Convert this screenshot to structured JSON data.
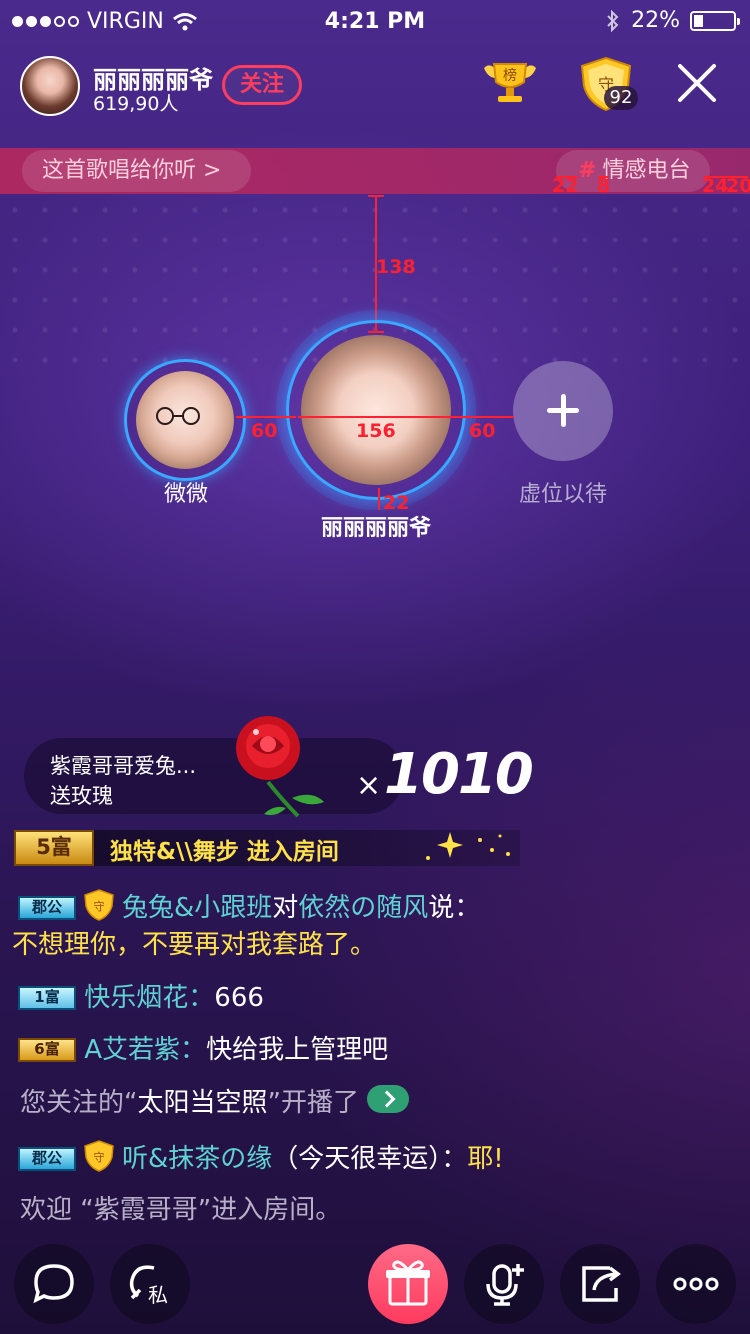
{
  "status_bar": {
    "carrier": "VIRGIN",
    "time": "4:21 PM",
    "battery": "22%"
  },
  "host": {
    "name": "丽丽丽丽爷",
    "audience": "619,90人",
    "follow_label": "关注"
  },
  "header": {
    "rank_icon_label": "榜",
    "guard_icon_label": "守",
    "guard_count": "92"
  },
  "banner": {
    "song_text": "这首歌唱给你听 >",
    "radio_hash": "#",
    "radio_tag": "情感电台"
  },
  "measurements": {
    "top_gap": "138",
    "left_gap": "60",
    "center_size": "156",
    "right_gap": "60",
    "name_gap": "22",
    "tag_pad_left": "22",
    "tag_hash_gap": "8",
    "tag_pad_right_a": "24",
    "tag_pad_right_b": "20"
  },
  "seats": {
    "left_name": "微微",
    "main_name": "丽丽丽丽爷",
    "empty_label": "虚位以待"
  },
  "gift_toast": {
    "from": "紫霞哥哥爱兔...",
    "action": "送玫瑰",
    "x": "×",
    "count": "1010"
  },
  "enter_notice": {
    "badge": "5富",
    "text": "独特&\\\\舞步 进入房间"
  },
  "chat": [
    {
      "badge": "郡公",
      "shield": "守",
      "user": "兔兔&小跟班",
      "mid": "对",
      "target": "依然の随风",
      "say": "说：",
      "message": "不想理你，不要再对我套路了。"
    },
    {
      "badge": "1富",
      "user": "快乐烟花：",
      "message": "666"
    },
    {
      "badge": "6富",
      "user": "A艾若紫：",
      "message": "快给我上管理吧"
    },
    {
      "prefix": "您关注的“",
      "highlight": "太阳当空照",
      "suffix": "”开播了"
    },
    {
      "badge": "郡公",
      "shield": "守",
      "user": "听&抹茶の缘",
      "mid": "（今天很幸运）：",
      "message": "耶!"
    },
    {
      "text": "欢迎 “紫霞哥哥”进入房间。"
    }
  ],
  "bottom_bar": {
    "private_label": "私"
  },
  "colors": {
    "accent_red": "#ff3d5e",
    "cyan_name": "#5fd2d2",
    "yellow_text": "#ffe14a",
    "ring_blue": "#3aa8ff"
  }
}
